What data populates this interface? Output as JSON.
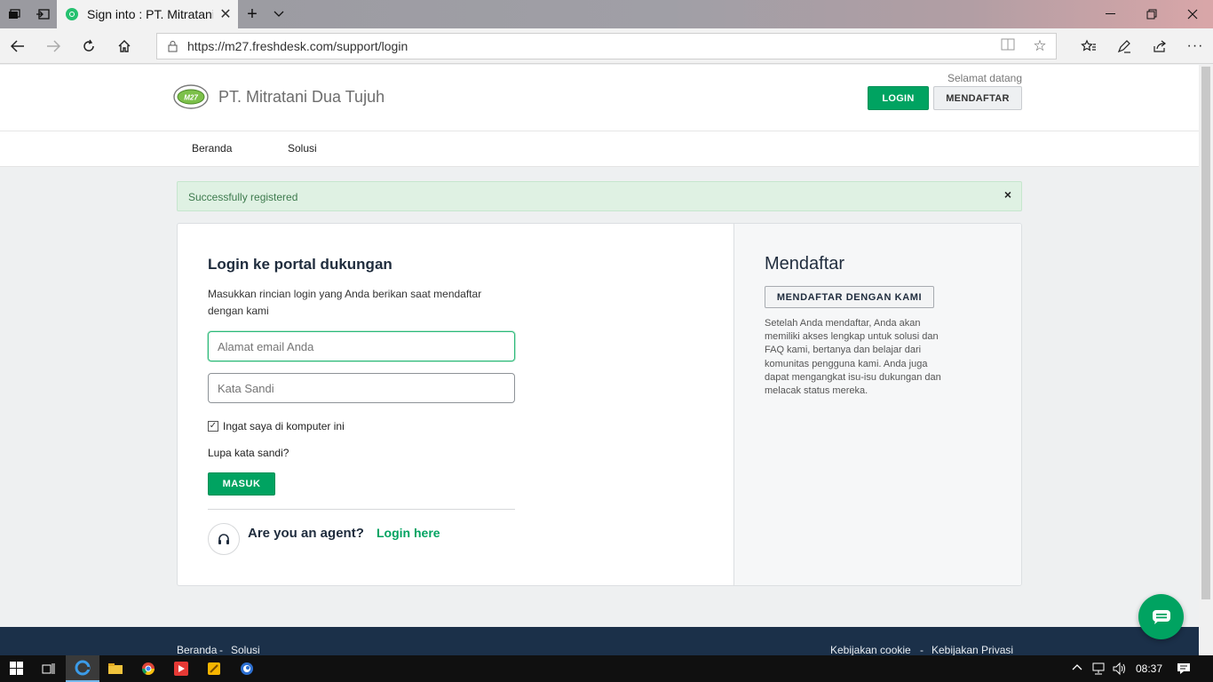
{
  "browser": {
    "tab_title": "Sign into : PT. Mitratani",
    "url": "https://m27.freshdesk.com/support/login"
  },
  "header": {
    "brand": "PT. Mitratani Dua Tujuh",
    "welcome": "Selamat datang",
    "login_label": "LOGIN",
    "signup_label": "MENDAFTAR"
  },
  "nav": {
    "items": [
      "Beranda",
      "Solusi"
    ]
  },
  "alert": {
    "message": "Successfully registered",
    "close": "×"
  },
  "login": {
    "title": "Login ke portal dukungan",
    "description": "Masukkan rincian login yang Anda berikan saat mendaftar dengan kami",
    "email_placeholder": "Alamat email Anda",
    "password_placeholder": "Kata Sandi",
    "remember_label": "Ingat saya di komputer ini",
    "remember_checked": true,
    "forgot_label": "Lupa kata sandi?",
    "submit_label": "MASUK",
    "agent_question": "Are you an agent?",
    "agent_link": "Login here"
  },
  "signup": {
    "title": "Mendaftar",
    "button_label": "MENDAFTAR DENGAN KAMI",
    "description": "Setelah Anda mendaftar, Anda akan memiliki akses lengkap untuk solusi dan FAQ kami, bertanya dan belajar dari komunitas pengguna kami. Anda juga dapat mengangkat isu-isu dukungan dan melacak status mereka."
  },
  "footer": {
    "left_links": [
      "Beranda",
      "Solusi"
    ],
    "separator": "-",
    "right_links": [
      "Kebijakan cookie",
      "Kebijakan Privasi"
    ]
  },
  "taskbar": {
    "time": "08:37"
  },
  "colors": {
    "accent": "#00a361",
    "footer_bg": "#1b3049",
    "alert_bg": "#dff1e3"
  }
}
